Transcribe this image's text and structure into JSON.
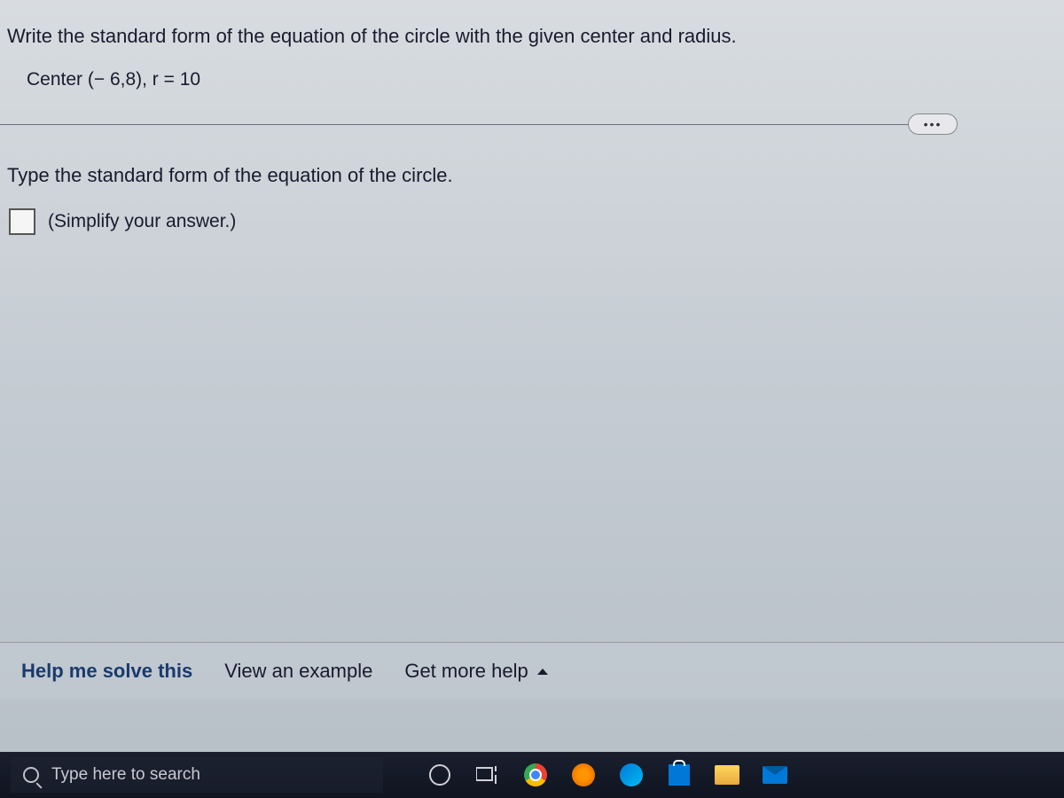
{
  "problem": {
    "statement": "Write the standard form of the equation of the circle with the given center and radius.",
    "details": "Center (− 6,8),   r = 10"
  },
  "instruction": "Type the standard form of the equation of the circle.",
  "hint": "(Simplify your answer.)",
  "ellipsis": "•••",
  "help_links": {
    "solve": "Help me solve this",
    "example": "View an example",
    "more": "Get more help"
  },
  "taskbar": {
    "search_placeholder": "Type here to search"
  }
}
